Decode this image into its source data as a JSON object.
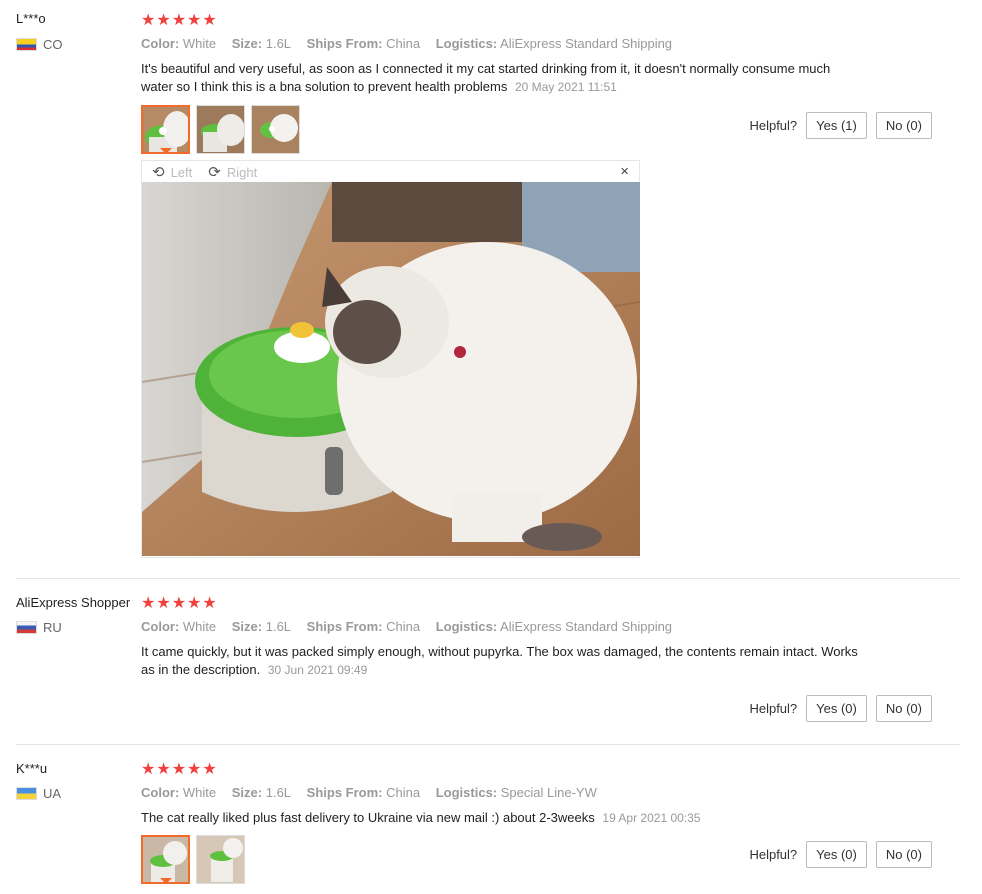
{
  "reviews": [
    {
      "user": "L***o",
      "country": "CO",
      "stars": "★★★★★",
      "spec_labels": {
        "color": "Color:",
        "size": "Size:",
        "ships": "Ships From:",
        "logistics": "Logistics:"
      },
      "color": "White",
      "size": "1.6L",
      "ships_from": "China",
      "logistics": "AliExpress Standard Shipping",
      "text": "It's beautiful and very useful, as soon as I connected it my cat started drinking from it, it doesn't normally consume much water so I think this is a bna solution to prevent health problems",
      "date": "20 May 2021 11:51",
      "helpful_label": "Helpful?",
      "yes_label": "Yes (1)",
      "no_label": "No (0)"
    },
    {
      "user": "AliExpress Shopper",
      "country": "RU",
      "stars": "★★★★★",
      "color": "White",
      "size": "1.6L",
      "ships_from": "China",
      "logistics": "AliExpress Standard Shipping",
      "text": "It came quickly, but it was packed simply enough, without pupyrka. The box was damaged, the contents remain intact. Works as in the description.",
      "date": "30 Jun 2021 09:49",
      "helpful_label": "Helpful?",
      "yes_label": "Yes (0)",
      "no_label": "No (0)"
    },
    {
      "user": "K***u",
      "country": "UA",
      "stars": "★★★★★",
      "color": "White",
      "size": "1.6L",
      "ships_from": "China",
      "logistics": "Special Line-YW",
      "text": "The cat really liked plus fast delivery to Ukraine via new mail :) about 2-3weeks",
      "date": "19 Apr 2021 00:35",
      "helpful_label": "Helpful?",
      "yes_label": "Yes (0)",
      "no_label": "No (0)"
    }
  ],
  "viewer": {
    "left_label": "Left",
    "right_label": "Right",
    "close_symbol": "×",
    "rotate_left_icon": "rotate-left-icon",
    "rotate_right_icon": "rotate-right-icon"
  },
  "colors": {
    "star": "#f0413f",
    "active_thumb": "#f26b2b"
  }
}
